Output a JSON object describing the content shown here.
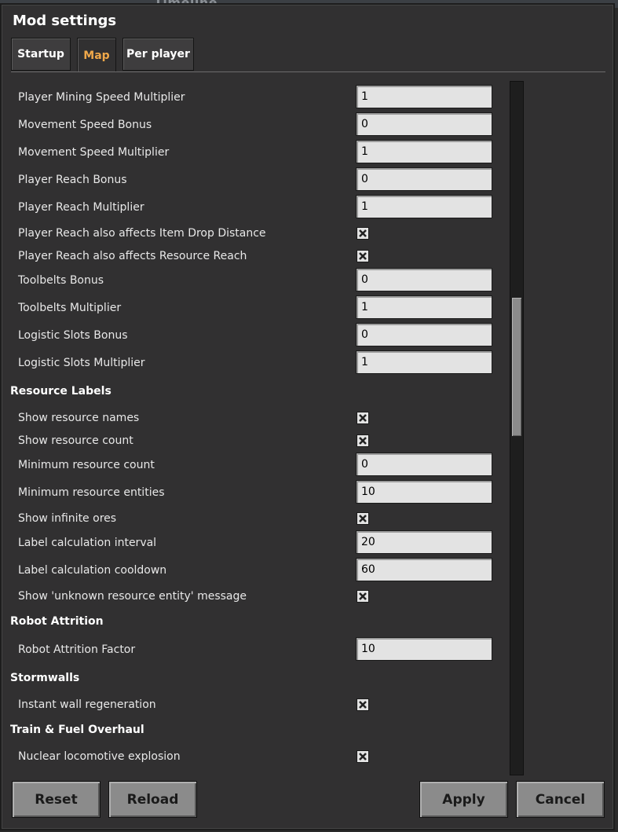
{
  "window": {
    "title": "Mod settings"
  },
  "background": {
    "ghost_tab": "Timeline"
  },
  "tabs": [
    {
      "label": "Startup",
      "active": false
    },
    {
      "label": "Map",
      "active": true
    },
    {
      "label": "Per player",
      "active": false
    }
  ],
  "settings": [
    {
      "label": "Player Mining Speed Multiplier",
      "value": "1"
    },
    {
      "label": "Movement Speed Bonus",
      "value": "0"
    },
    {
      "label": "Movement Speed Multiplier",
      "value": "1"
    },
    {
      "label": "Player Reach Bonus",
      "value": "0"
    },
    {
      "label": "Player Reach Multiplier",
      "value": "1"
    },
    {
      "label": "Player Reach also affects Item Drop Distance",
      "checked": true
    },
    {
      "label": "Player Reach also affects Resource Reach",
      "checked": true
    },
    {
      "label": "Toolbelts Bonus",
      "value": "0"
    },
    {
      "label": "Toolbelts Multiplier",
      "value": "1"
    },
    {
      "label": "Logistic Slots Bonus",
      "value": "0"
    },
    {
      "label": "Logistic Slots Multiplier",
      "value": "1"
    }
  ],
  "sections": [
    {
      "title": "Resource Labels",
      "settings": [
        {
          "label": "Show resource names",
          "checked": true
        },
        {
          "label": "Show resource count",
          "checked": true
        },
        {
          "label": "Minimum resource count",
          "value": "0"
        },
        {
          "label": "Minimum resource entities",
          "value": "10"
        },
        {
          "label": "Show infinite ores",
          "checked": true
        },
        {
          "label": "Label calculation interval",
          "value": "20"
        },
        {
          "label": "Label calculation cooldown",
          "value": "60"
        },
        {
          "label": "Show 'unknown resource entity' message",
          "checked": true
        }
      ]
    },
    {
      "title": "Robot Attrition",
      "settings": [
        {
          "label": "Robot Attrition Factor",
          "value": "10"
        }
      ]
    },
    {
      "title": "Stormwalls",
      "settings": [
        {
          "label": "Instant wall regeneration",
          "checked": true
        }
      ]
    },
    {
      "title": "Train & Fuel Overhaul",
      "settings": [
        {
          "label": "Nuclear locomotive explosion",
          "checked": true
        }
      ]
    }
  ],
  "scroll": {
    "position": 0.39,
    "visible_fraction": 0.2
  },
  "buttons": {
    "reset": "Reset",
    "reload": "Reload",
    "apply": "Apply",
    "cancel": "Cancel"
  },
  "icons": {
    "checkbox_checked": "x-mark-icon"
  }
}
